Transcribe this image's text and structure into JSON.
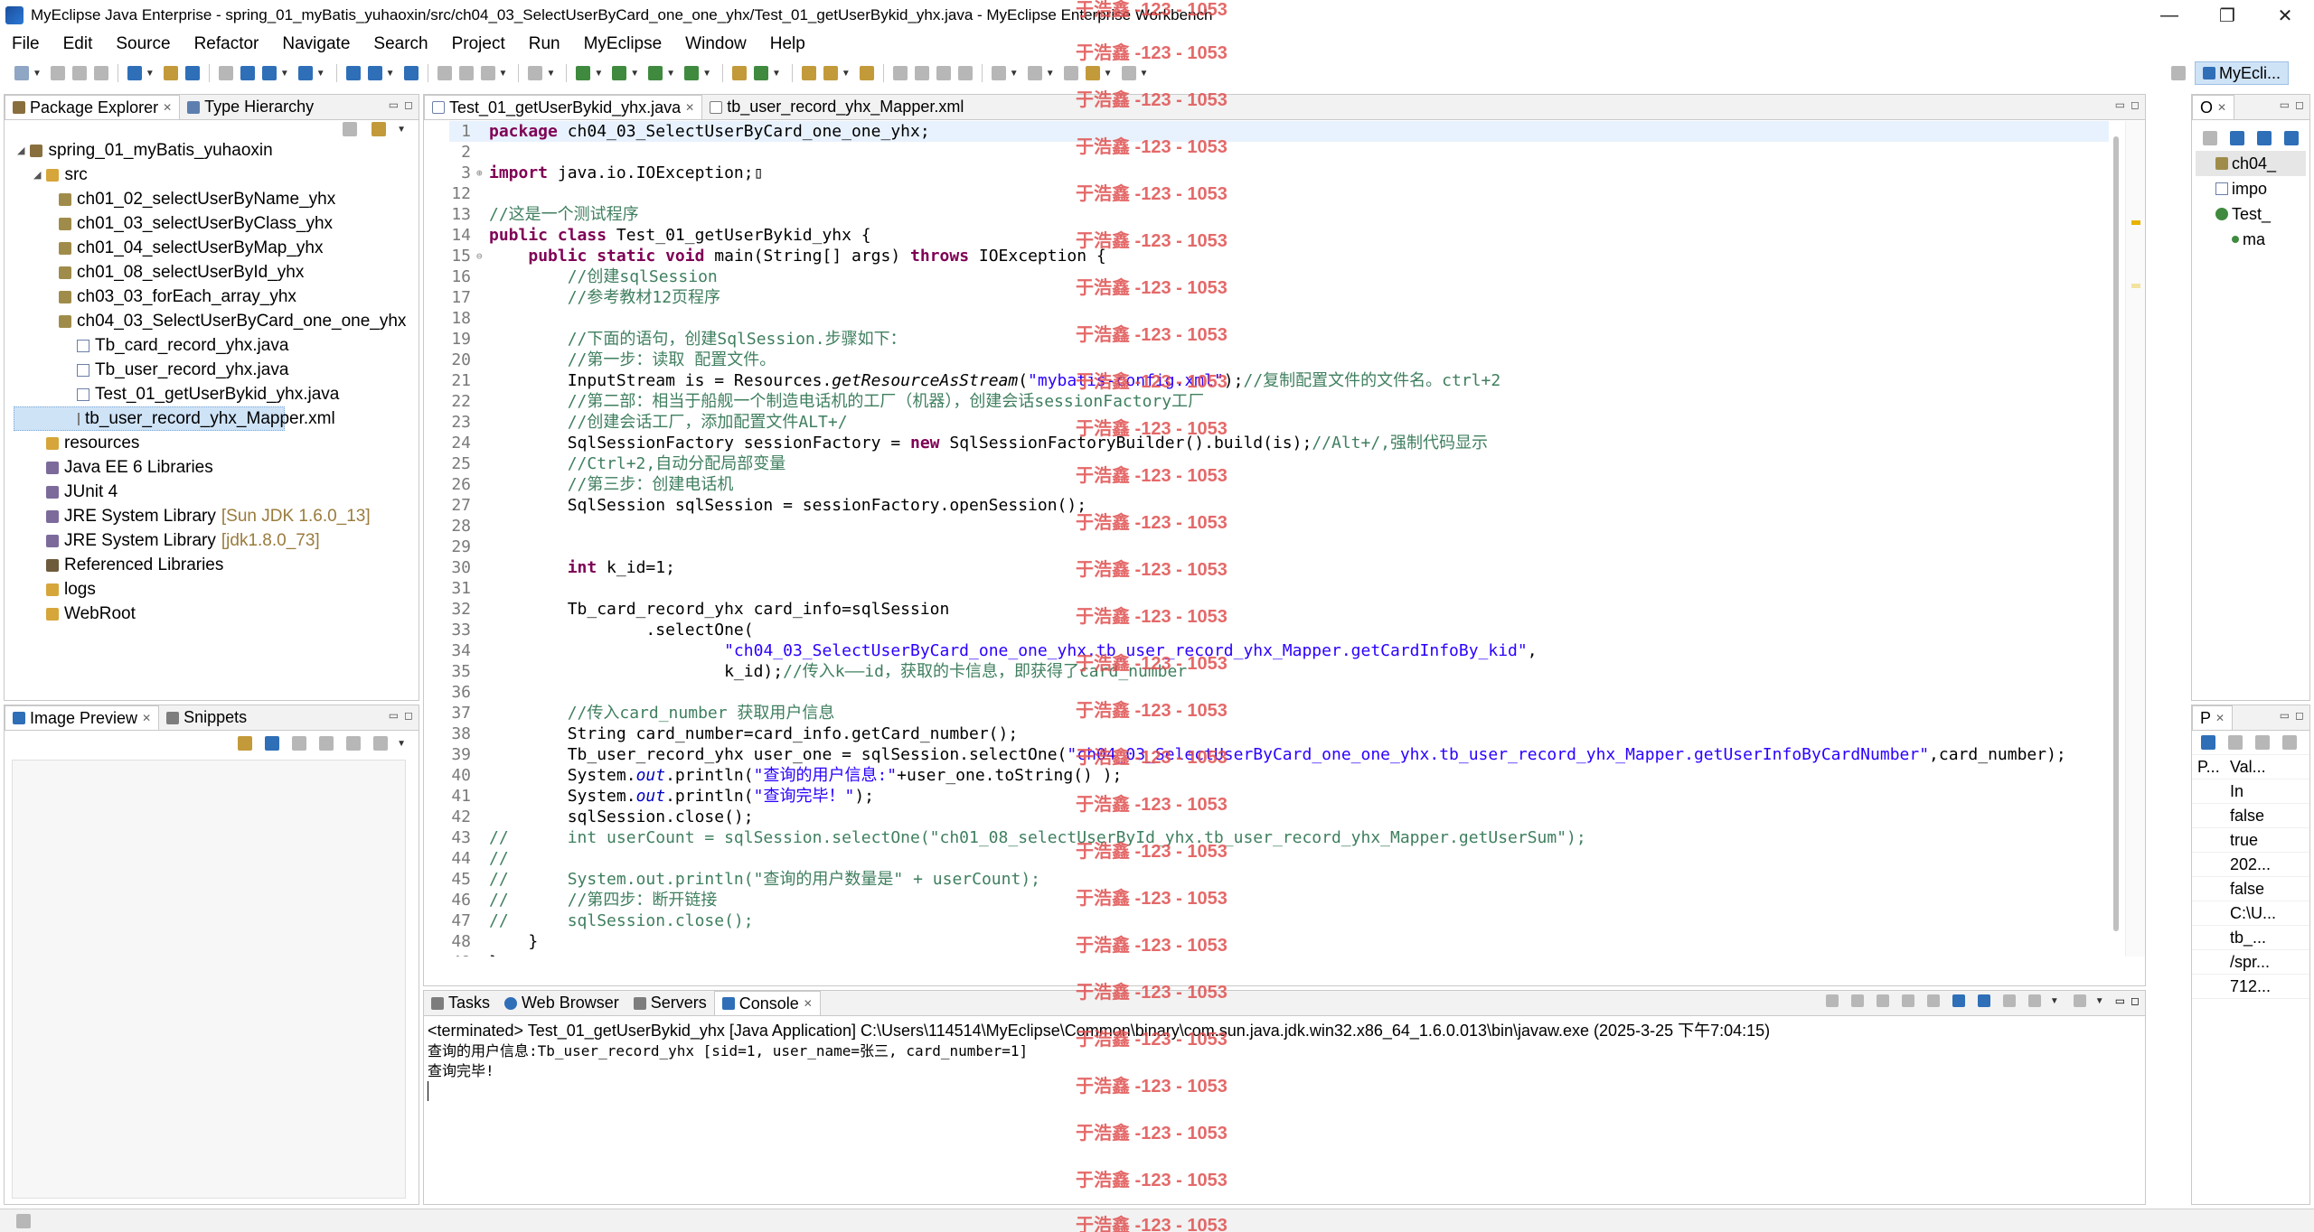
{
  "window": {
    "title": "MyEclipse Java Enterprise - spring_01_myBatis_yuhaoxin/src/ch04_03_SelectUserByCard_one_one_yhx/Test_01_getUserBykid_yhx.java - MyEclipse Enterprise Workbench",
    "minimize": "—",
    "maximize": "❐",
    "close": "✕"
  },
  "menu": [
    "File",
    "Edit",
    "Source",
    "Refactor",
    "Navigate",
    "Search",
    "Project",
    "Run",
    "MyEclipse",
    "Window",
    "Help"
  ],
  "perspective": {
    "label": "MyEcli..."
  },
  "package_explorer": {
    "tab_label": "Package Explorer",
    "tab2_label": "Type Hierarchy",
    "project": "spring_01_myBatis_yuhaoxin",
    "src": "src",
    "packages": [
      "ch01_02_selectUserByName_yhx",
      "ch01_03_selectUserByClass_yhx",
      "ch01_04_selectUserByMap_yhx",
      "ch01_08_selectUserById_yhx",
      "ch03_03_forEach_array_yhx",
      "ch04_03_SelectUserByCard_one_one_yhx"
    ],
    "files": [
      "Tb_card_record_yhx.java",
      "Tb_user_record_yhx.java",
      "Test_01_getUserBykid_yhx.java",
      "tb_user_record_yhx_Mapper.xml"
    ],
    "other": {
      "resources": "resources",
      "javaee": "Java EE 6 Libraries",
      "junit": "JUnit 4",
      "jre1_label": "JRE System Library",
      "jre1_ver": "[Sun JDK 1.6.0_13]",
      "jre2_label": "JRE System Library",
      "jre2_ver": "[jdk1.8.0_73]",
      "reflibs": "Referenced Libraries",
      "logs": "logs",
      "webroot": "WebRoot"
    }
  },
  "image_preview": {
    "tab_label": "Image Preview",
    "tab2_label": "Snippets"
  },
  "editor": {
    "tab1": "Test_01_getUserBykid_yhx.java",
    "tab2": "tb_user_record_yhx_Mapper.xml"
  },
  "console": {
    "tabs": [
      "Tasks",
      "Web Browser",
      "Servers",
      "Console"
    ],
    "header": "<terminated> Test_01_getUserBykid_yhx [Java Application] C:\\Users\\114514\\MyEclipse\\Common\\binary\\com.sun.java.jdk.win32.x86_64_1.6.0.013\\bin\\javaw.exe (2025-3-25 下午7:04:15)",
    "output": [
      "查询的用户信息:Tb_user_record_yhx [sid=1, user_name=张三, card_number=1]",
      "查询完毕!",
      ""
    ]
  },
  "outline": {
    "tab_label": "O",
    "items": [
      "ch04_",
      "impo",
      "Test_",
      "ma"
    ]
  },
  "properties": {
    "tab_label": "P",
    "col_key": "P...",
    "col_val": "Val...",
    "rows": [
      {
        "k": "",
        "v": "In"
      },
      {
        "k": "",
        "v": "false"
      },
      {
        "k": "",
        "v": "true"
      },
      {
        "k": "",
        "v": "202..."
      },
      {
        "k": "",
        "v": "false"
      },
      {
        "k": "",
        "v": "C:\\U..."
      },
      {
        "k": "",
        "v": "tb_..."
      },
      {
        "k": "",
        "v": "/spr..."
      },
      {
        "k": "",
        "v": "712..."
      }
    ]
  },
  "watermark": "于浩鑫 -123 - 1053"
}
